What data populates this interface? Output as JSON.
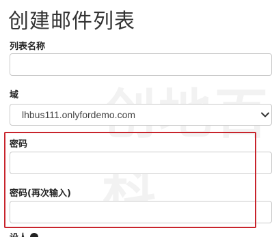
{
  "page": {
    "title": "创建邮件列表"
  },
  "form": {
    "list_name_label": "列表名称",
    "list_name_value": "",
    "domain_label": "域",
    "domain_selected": "lhbus111.onlyfordemo.com",
    "password_label": "密码",
    "password_value": "",
    "password_confirm_label": "密码(再次输入)",
    "password_confirm_value": "",
    "next_label_partial": "设人"
  },
  "watermark": "创地百科",
  "colors": {
    "highlight_border": "#c8242c",
    "input_border": "#c9c9c9"
  },
  "icons": {
    "domain_select_chevron": "chevron-down-icon",
    "help": "info-icon"
  }
}
